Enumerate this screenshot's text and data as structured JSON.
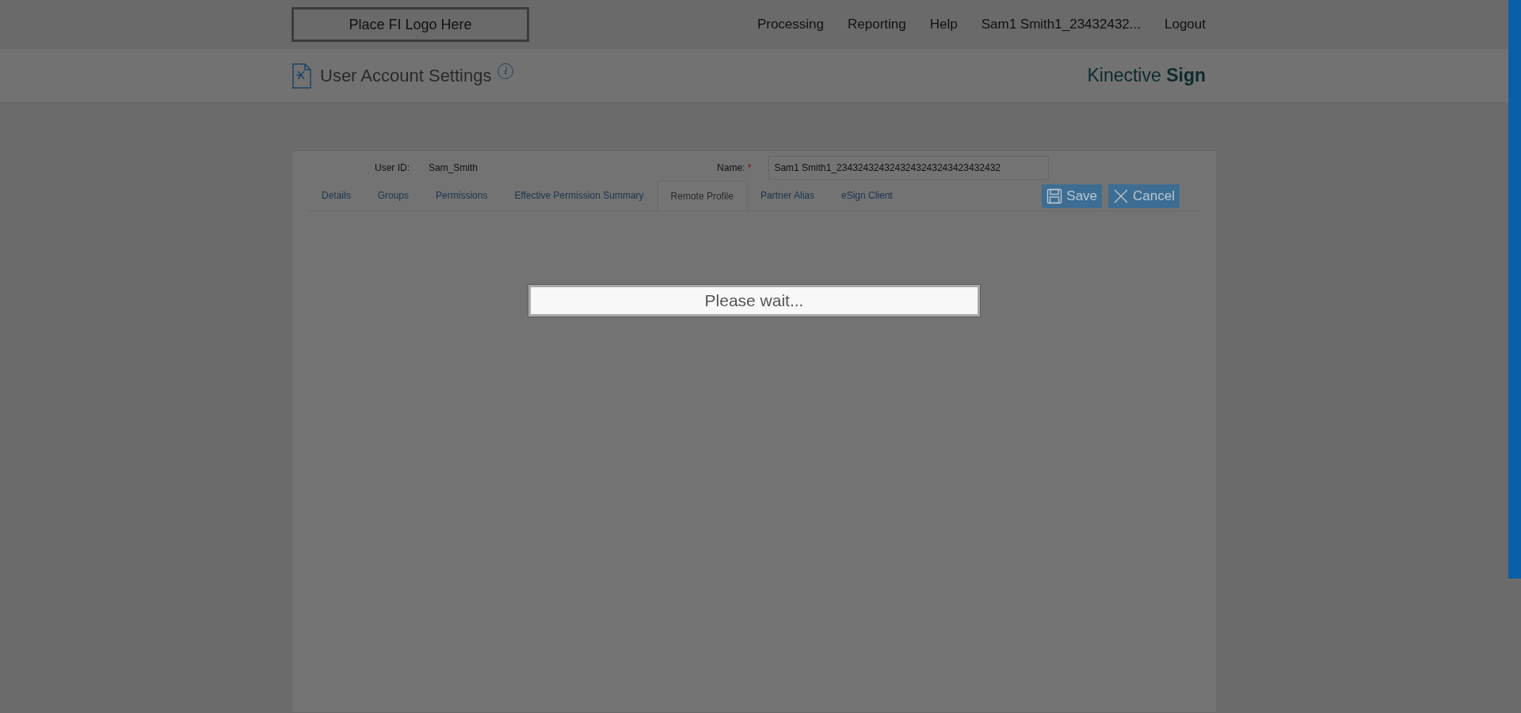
{
  "header": {
    "logo": "Place FI Logo Here",
    "nav": [
      "Processing",
      "Reporting",
      "Help",
      "Sam1 Smith1_23432432...",
      "Logout"
    ]
  },
  "title_bar": {
    "title": "User Account Settings",
    "info": "i",
    "brand": "Kinective",
    "brand_bold": "Sign"
  },
  "form": {
    "user_id_label": "User ID:",
    "user_id": "Sam_Smith",
    "name_label": "Name:",
    "required_mark": "*",
    "name_value": "Sam1 Smith1_2343243243243243243243423432432"
  },
  "tabs": [
    {
      "label": "Details",
      "selected": false
    },
    {
      "label": "Groups",
      "selected": false
    },
    {
      "label": "Permissions",
      "selected": false
    },
    {
      "label": "Effective Permission Summary",
      "selected": false
    },
    {
      "label": "Remote Profile",
      "selected": true
    },
    {
      "label": "Partner Alias",
      "selected": false
    },
    {
      "label": "eSign Client",
      "selected": false
    }
  ],
  "buttons": [
    {
      "kind": "save",
      "label": "Save"
    },
    {
      "kind": "cancel",
      "label": "Cancel"
    }
  ],
  "dialog": {
    "message": "Please wait..."
  }
}
